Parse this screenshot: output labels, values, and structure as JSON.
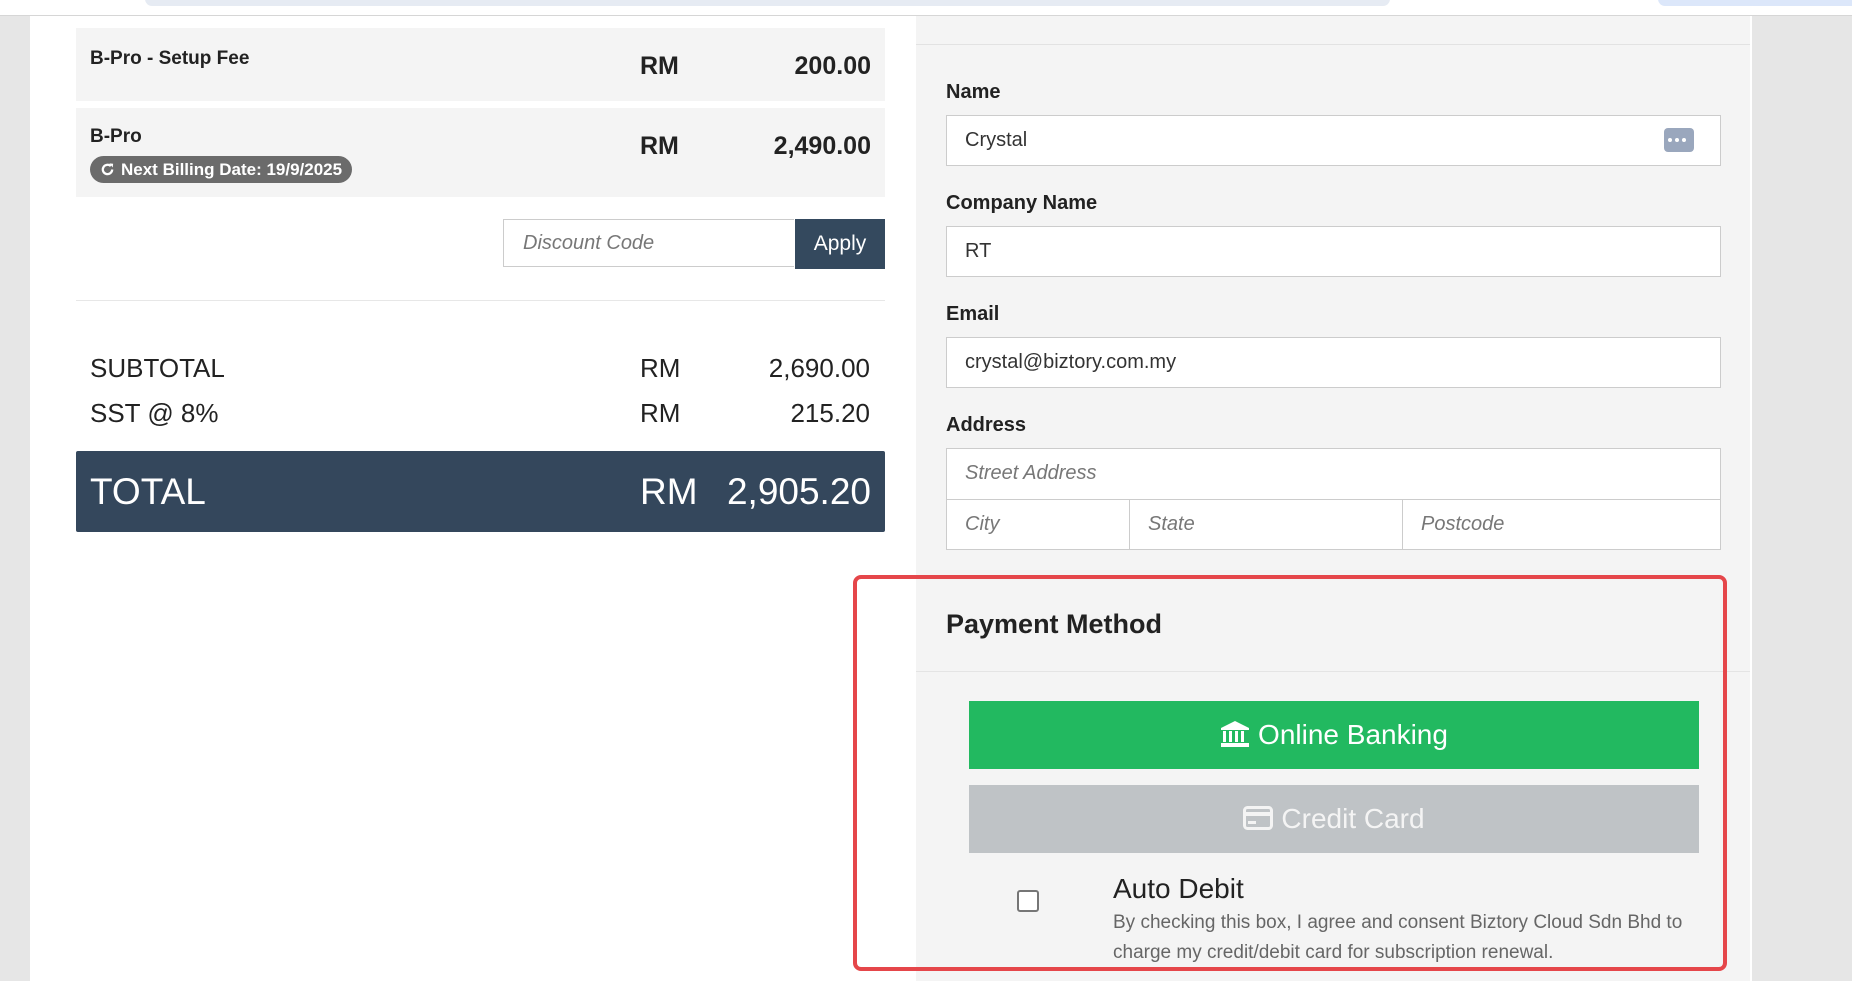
{
  "items": [
    {
      "name": "B-Pro - Setup Fee",
      "currency": "RM",
      "amount": "200.00"
    },
    {
      "name": "B-Pro",
      "currency": "RM",
      "amount": "2,490.00",
      "badge": "Next Billing Date: 19/9/2025"
    }
  ],
  "discount": {
    "placeholder": "Discount Code",
    "apply_label": "Apply"
  },
  "summary": {
    "subtotal": {
      "label": "SUBTOTAL",
      "currency": "RM",
      "amount": "2,690.00"
    },
    "sst": {
      "label": "SST @ 8%",
      "currency": "RM",
      "amount": "215.20"
    },
    "total": {
      "label": "TOTAL",
      "currency": "RM",
      "amount": "2,905.20"
    }
  },
  "form": {
    "name_label": "Name",
    "name_value": "Crystal",
    "company_label": "Company Name",
    "company_value": "RT",
    "email_label": "Email",
    "email_value": "crystal@biztory.com.my",
    "address_label": "Address",
    "street_placeholder": "Street Address",
    "city_placeholder": "City",
    "state_placeholder": "State",
    "postcode_placeholder": "Postcode"
  },
  "payment": {
    "title": "Payment Method",
    "online_banking": "Online Banking",
    "credit_card": "Credit Card",
    "auto_debit_title": "Auto Debit",
    "auto_debit_desc": "By checking this box, I agree and consent Biztory Cloud Sdn Bhd to charge my credit/debit card for subscription renewal.",
    "online_color": "#22b960",
    "credit_color": "#bfc3c6",
    "highlight_color": "#e5464a"
  }
}
